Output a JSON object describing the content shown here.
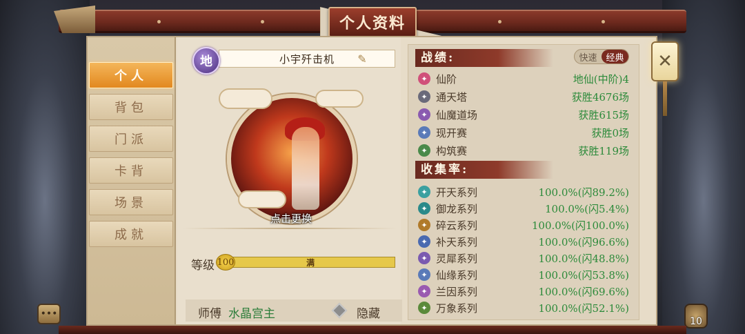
{
  "header": {
    "title": "个人资料"
  },
  "sidebar": {
    "items": [
      {
        "label": "个人",
        "active": true
      },
      {
        "label": "背包",
        "active": false
      },
      {
        "label": "门派",
        "active": false
      },
      {
        "label": "卡背",
        "active": false
      },
      {
        "label": "场景",
        "active": false
      },
      {
        "label": "成就",
        "active": false
      }
    ]
  },
  "profile": {
    "realm_badge": "地",
    "name": "小宇歼击机",
    "edit_icon": "brush-icon",
    "avatar_change_label": "点击更换",
    "level_label": "等级",
    "level_value": "100",
    "level_bar_text": "满",
    "level_progress": 1.0,
    "master_label": "师傅",
    "master_name": "水晶宫主",
    "hide_label": "隐藏"
  },
  "record": {
    "title": "战绩:",
    "mode_quick": "快速",
    "mode_classic": "经典",
    "rows": [
      {
        "label": "仙阶",
        "value": "地仙(中阶)4",
        "icon": "star-icon",
        "color": "#d0507a"
      },
      {
        "label": "通天塔",
        "value": "获胜4676场",
        "icon": "tower-icon",
        "color": "#6a6a7a"
      },
      {
        "label": "仙魔道场",
        "value": "获胜615场",
        "icon": "yin-yang-icon",
        "color": "#8a5ab0"
      },
      {
        "label": "现开赛",
        "value": "获胜0场",
        "icon": "search-icon",
        "color": "#5a7ab8"
      },
      {
        "label": "构筑赛",
        "value": "获胜119场",
        "icon": "build-icon",
        "color": "#4a8a4a"
      }
    ]
  },
  "collection": {
    "title": "收集率:",
    "rows": [
      {
        "label": "开天系列",
        "value": "100.0%(闪89.2%)",
        "icon": "sky-icon",
        "color": "#3aa0a0"
      },
      {
        "label": "御龙系列",
        "value": "100.0%(闪5.4%)",
        "icon": "dragon-icon",
        "color": "#2a8a8a"
      },
      {
        "label": "碎云系列",
        "value": "100.0%(闪100.0%)",
        "icon": "cloud-icon",
        "color": "#b07a2a"
      },
      {
        "label": "补天系列",
        "value": "100.0%(闪96.6%)",
        "icon": "cloud-icon",
        "color": "#4a6ab0"
      },
      {
        "label": "灵犀系列",
        "value": "100.0%(闪48.8%)",
        "icon": "horn-icon",
        "color": "#7a5ab0"
      },
      {
        "label": "仙缘系列",
        "value": "100.0%(闪53.8%)",
        "icon": "eye-icon",
        "color": "#5a7ab8"
      },
      {
        "label": "兰因系列",
        "value": "100.0%(闪69.6%)",
        "icon": "orchid-icon",
        "color": "#9a5ab0"
      },
      {
        "label": "万象系列",
        "value": "100.0%(闪52.1%)",
        "icon": "leaf-icon",
        "color": "#5a8a3a"
      }
    ]
  },
  "footer": {
    "gift_count": "10"
  }
}
